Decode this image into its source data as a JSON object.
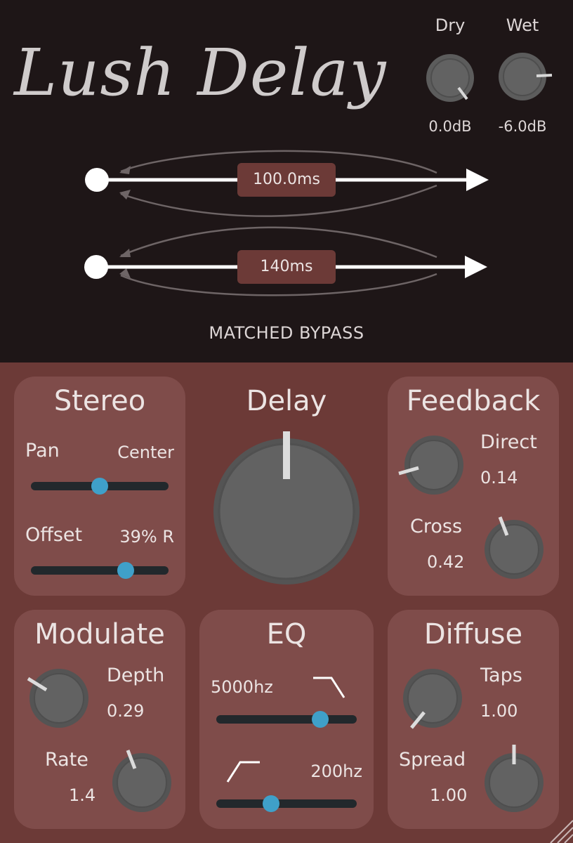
{
  "header": {
    "title": "Lush Delay",
    "dry": {
      "label": "Dry",
      "value": "0.0dB"
    },
    "wet": {
      "label": "Wet",
      "value": "-6.0dB"
    }
  },
  "taps": {
    "left_time": "100.0ms",
    "right_time": "140ms"
  },
  "bypass_label": "MATCHED BYPASS",
  "stereo": {
    "title": "Stereo",
    "pan_label": "Pan",
    "pan_value": "Center",
    "pan_position": 0.5,
    "offset_label": "Offset",
    "offset_value": "39% R",
    "offset_position": 0.69
  },
  "delay": {
    "title": "Delay"
  },
  "feedback": {
    "title": "Feedback",
    "direct_label": "Direct",
    "direct_value": "0.14",
    "cross_label": "Cross",
    "cross_value": "0.42"
  },
  "modulate": {
    "title": "Modulate",
    "depth_label": "Depth",
    "depth_value": "0.29",
    "rate_label": "Rate",
    "rate_value": "1.4"
  },
  "eq": {
    "title": "EQ",
    "highcut_value": "5000hz",
    "highcut_position": 0.74,
    "lowcut_value": "200hz",
    "lowcut_position": 0.39
  },
  "diffuse": {
    "title": "Diffuse",
    "taps_label": "Taps",
    "taps_value": "1.00",
    "spread_label": "Spread",
    "spread_value": "1.00"
  },
  "colors": {
    "top_background": "#1e1617",
    "body_background": "#6c3a37",
    "panel_background": "#7f4c4a",
    "slider_thumb": "#3fa0c9",
    "slider_track": "#22282c"
  }
}
